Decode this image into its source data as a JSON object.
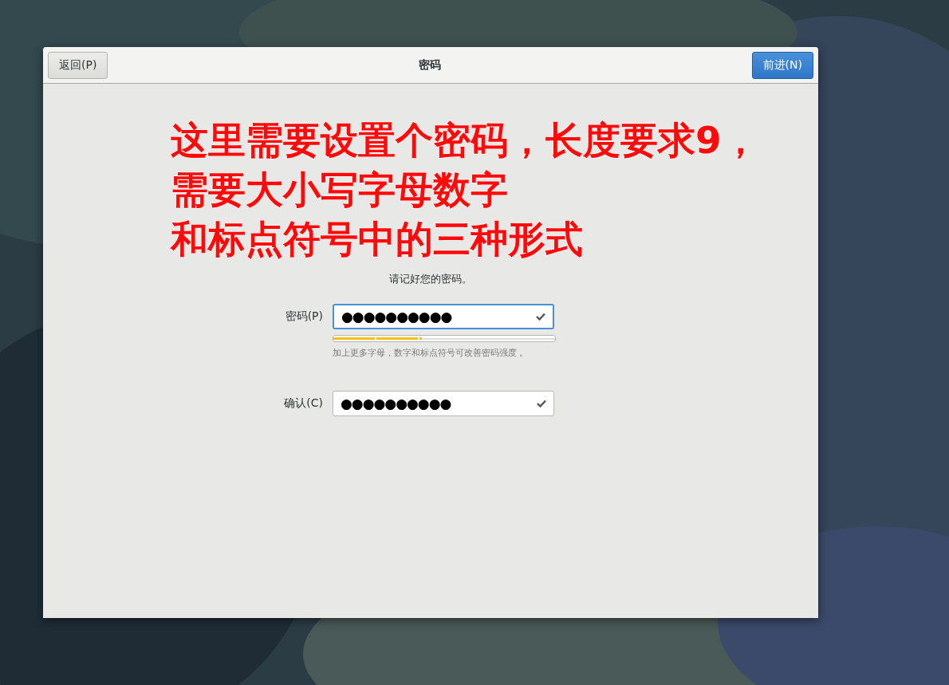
{
  "window": {
    "title": "密码",
    "back_button": "返回(P)",
    "next_button": "前进(N)"
  },
  "page": {
    "subtitle": "请记好您的密码。"
  },
  "fields": [
    {
      "label": "密码(P)",
      "value": "●●●●●●●●●●",
      "focused": true,
      "valid": true
    },
    {
      "label": "确认(C)",
      "value": "●●●●●●●●●●",
      "focused": false,
      "valid": true
    }
  ],
  "strength": {
    "level": 0.4,
    "hint": "加上更多字母，数字和标点符号可改善密码强度 。"
  },
  "annotation": {
    "lines": [
      "这里需要设置个密码，长度要求9，",
      "需要大小写字母数字",
      "和标点符号中的三种形式"
    ]
  }
}
